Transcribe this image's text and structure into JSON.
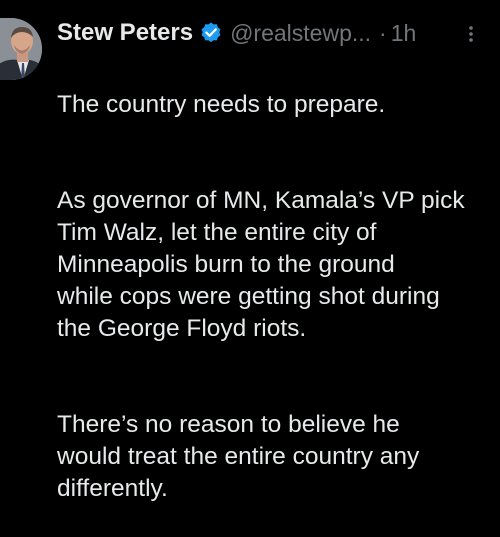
{
  "post": {
    "author": {
      "display_name": "Stew Peters",
      "handle": "@realstewp...",
      "verified_icon": "verified-badge-icon",
      "avatar_icon": "profile-photo"
    },
    "separator": "·",
    "timestamp": "1h",
    "more_icon": "more-vertical-icon",
    "body": {
      "paragraph_1": "The country needs to prepare.",
      "paragraph_2": "As governor of MN, Kamala’s VP pick\nTim Walz, let the entire city of\nMinneapolis burn to the ground\nwhile cops were getting shot during\nthe George Floyd riots.",
      "paragraph_3": "There’s no reason to believe he\nwould treat the entire country any\ndifferently."
    }
  },
  "colors": {
    "background": "#000000",
    "text_primary": "#e7e9ea",
    "text_secondary": "#71767b",
    "verified_blue": "#1d9bf0"
  }
}
